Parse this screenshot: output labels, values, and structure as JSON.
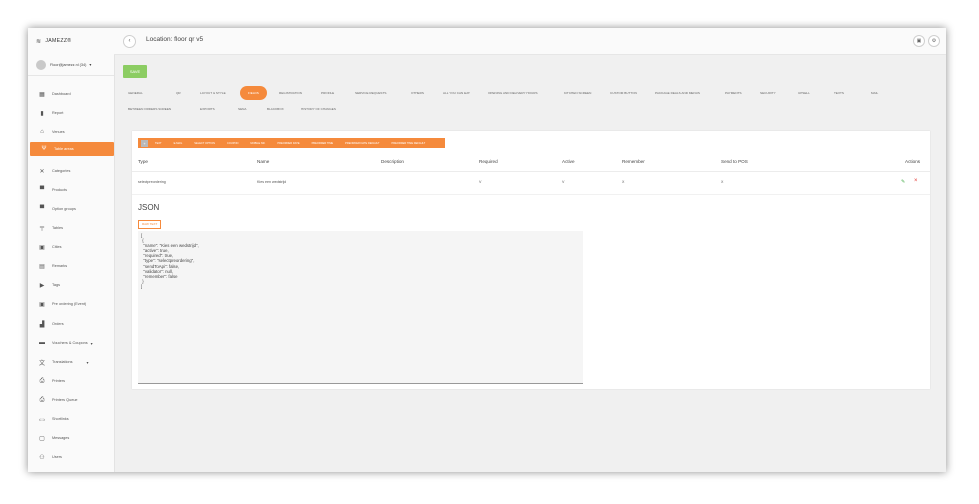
{
  "app": {
    "brand": "JAMEZZ®"
  },
  "user": {
    "name": "Floor@jamezz.nl (34)"
  },
  "sidebar": {
    "items": [
      {
        "label": "Dashboard",
        "icon": "dashboard-icon",
        "glyph": "▦"
      },
      {
        "label": "Report",
        "icon": "bar-chart-icon",
        "glyph": "▮"
      },
      {
        "label": "Venues",
        "icon": "home-icon",
        "glyph": "⌂"
      },
      {
        "label": "Table areas",
        "icon": "utensils-icon",
        "glyph": "Ψ"
      },
      {
        "label": "Categories",
        "icon": "categories-icon",
        "glyph": "✕"
      },
      {
        "label": "Products",
        "icon": "products-icon",
        "glyph": "▀"
      },
      {
        "label": "Option groups",
        "icon": "option-groups-icon",
        "glyph": "▀"
      },
      {
        "label": "Tables",
        "icon": "tables-icon",
        "glyph": "╤"
      },
      {
        "label": "Cities",
        "icon": "cities-icon",
        "glyph": "▣"
      },
      {
        "label": "Remarks",
        "icon": "remarks-icon",
        "glyph": "▤"
      },
      {
        "label": "Tags",
        "icon": "tag-icon",
        "glyph": "▶"
      },
      {
        "label": "Pre ordering (Event)",
        "icon": "calendar-icon",
        "glyph": "▣"
      },
      {
        "label": "Orders",
        "icon": "orders-icon",
        "glyph": "▟"
      },
      {
        "label": "Vouchers & Coupons",
        "icon": "voucher-icon",
        "glyph": "▬"
      },
      {
        "label": "Translations",
        "icon": "translate-icon",
        "glyph": "文"
      },
      {
        "label": "Printers",
        "icon": "printer-icon",
        "glyph": "⎙"
      },
      {
        "label": "Printers Queue",
        "icon": "printer-queue-icon",
        "glyph": "⎙"
      },
      {
        "label": "Shortlinks",
        "icon": "link-icon",
        "glyph": "⊂⊃"
      },
      {
        "label": "Messages",
        "icon": "message-icon",
        "glyph": "▢"
      },
      {
        "label": "Users",
        "icon": "users-icon",
        "glyph": "⚇"
      }
    ]
  },
  "header": {
    "location": "Location: floor qr v5"
  },
  "toolbar": {
    "save_label": "SAVE"
  },
  "tabs": [
    "GENERAL",
    "QR",
    "LAYOUT & STYLE",
    "FIELDS",
    "REGISTRATION",
    "PROFILE",
    "SERVICE REQUESTS",
    "OTHERS",
    "ALL YOU CAN EAT",
    "OPENING AND DELIVERY HOURS",
    "KITCHEN SCREEN",
    "CUSTOM BUTTON",
    "PACKAGE DEALS AND MENUS",
    "PAYMENTS",
    "SECURITY",
    "UPSELL",
    "TEXTS",
    "MAIL",
    "BETWEEN ORDERS SCREEN",
    "EXPORTS",
    "SENA",
    "BLACKBOX",
    "HISTORY OF CHANGES"
  ],
  "field_buttons": [
    "TEXT",
    "E-MAIL",
    "SELECT OPTION",
    "COUPON",
    "MOBILE NR.",
    "PREORDER DATE",
    "PREORDER TIME",
    "PREORDER DATE DEFAULT",
    "PREORDER TIME DEFAULT"
  ],
  "table": {
    "headers": [
      "Type",
      "Name",
      "Description",
      "Required",
      "Active",
      "Remember",
      "Send to POS",
      "Actions"
    ],
    "rows": [
      {
        "type": "selectpreordering",
        "name": "Kies een wedstrijd",
        "description": "",
        "required": "V",
        "active": "V",
        "remember": "X",
        "send_to_pos": "X"
      }
    ]
  },
  "json_section": {
    "title": "JSON",
    "raw_label": "RAW TEXT",
    "content": "[\n {\n  \"name\": \"Kies een wedstrijd\",\n  \"active\": true,\n  \"required\": true,\n  \"type\": \"selectpreordering\",\n  \"sendToApi\": false,\n  \"validator\": null,\n  \"remember\": false\n }\n]"
  },
  "colors": {
    "accent": "#f58a3c",
    "save": "#8ccd63"
  }
}
